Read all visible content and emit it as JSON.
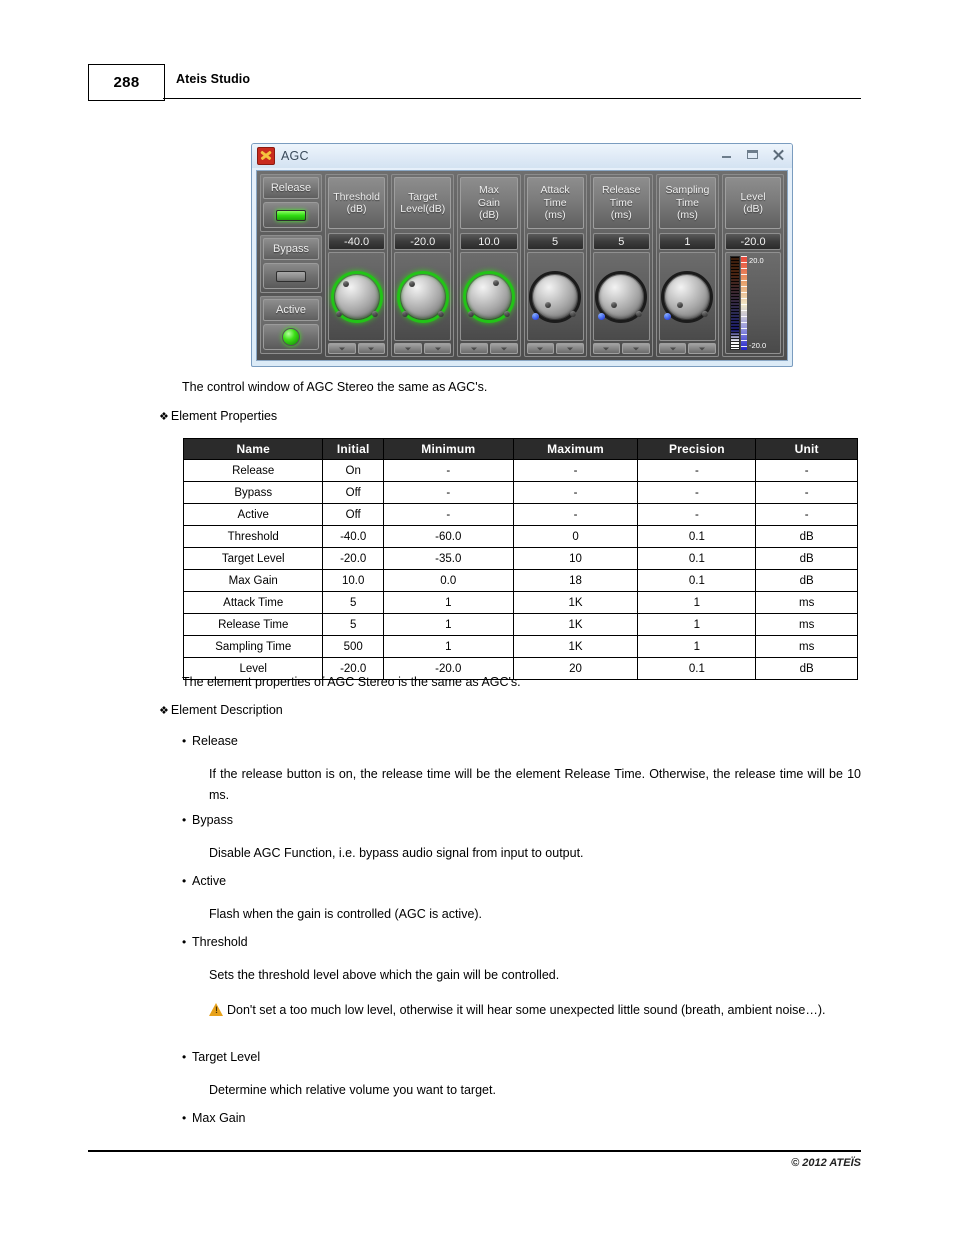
{
  "page": {
    "number": "288",
    "header_title": "Ateis Studio",
    "footer_copyright": "© 2012 ATEÏS"
  },
  "agc_window": {
    "title": "AGC",
    "app_icon": "ateis-logo-icon",
    "window_buttons": {
      "minimize": "minimize-icon",
      "maximize": "maximize-icon",
      "close": "close-icon"
    },
    "toggles": [
      {
        "label": "Release",
        "state": "on",
        "indicator": "led-bar"
      },
      {
        "label": "Bypass",
        "state": "off",
        "indicator": "led-bar"
      },
      {
        "label": "Active",
        "state": "on",
        "indicator": "led-round"
      }
    ],
    "parameters": [
      {
        "title_line1": "Threshold",
        "title_line2": "(dB)",
        "value": "-40.0",
        "knob_style": "green"
      },
      {
        "title_line1": "Target",
        "title_line2": "Level(dB)",
        "value": "-20.0",
        "knob_style": "green"
      },
      {
        "title_line1": "Max",
        "title_line2": "Gain",
        "title_line3": "(dB)",
        "value": "10.0",
        "knob_style": "green"
      },
      {
        "title_line1": "Attack",
        "title_line2": "Time",
        "title_line3": "(ms)",
        "value": "5",
        "knob_style": "dark"
      },
      {
        "title_line1": "Release",
        "title_line2": "Time",
        "title_line3": "(ms)",
        "value": "5",
        "knob_style": "dark"
      },
      {
        "title_line1": "Sampling",
        "title_line2": "Time",
        "title_line3": "(ms)",
        "value": "1",
        "knob_style": "dark"
      }
    ],
    "meter": {
      "title_line1": "Level",
      "title_line2": "(dB)",
      "value": "-20.0",
      "scale_top": "20.0",
      "scale_bottom": "-20.0"
    }
  },
  "body": {
    "intro_paragraph": "The control window of AGC Stereo the same as AGC's.",
    "section_element_properties": "Element Properties",
    "after_table_paragraph": "The element properties of AGC Stereo is the same as AGC's.",
    "section_element_description": "Element Description",
    "descriptions": [
      {
        "term": "Release",
        "text": "If the release button is on,  the release time will be the element Release Time.  Otherwise, the release time will be 10 ms."
      },
      {
        "term": "Bypass",
        "text": "Disable AGC Function, i.e. bypass audio signal from input to output."
      },
      {
        "term": "Active",
        "text": "Flash when the gain is controlled (AGC is active)."
      },
      {
        "term": "Threshold",
        "text": "Sets the threshold level above which the gain will be controlled.",
        "warning": "Don't set a too much low level, otherwise it will hear some unexpected little sound (breath, ambient noise…)."
      },
      {
        "term": "Target Level",
        "text": "Determine which relative volume you want to target."
      },
      {
        "term": "Max Gain",
        "text": ""
      }
    ]
  },
  "table": {
    "headers": [
      "Name",
      "Initial",
      "Minimum",
      "Maximum",
      "Precision",
      "Unit"
    ],
    "rows": [
      [
        "Release",
        "On",
        "-",
        "-",
        "-",
        "-"
      ],
      [
        "Bypass",
        "Off",
        "-",
        "-",
        "-",
        "-"
      ],
      [
        "Active",
        "Off",
        "-",
        "-",
        "-",
        "-"
      ],
      [
        "Threshold",
        "-40.0",
        "-60.0",
        "0",
        "0.1",
        "dB"
      ],
      [
        "Target Level",
        "-20.0",
        "-35.0",
        "10",
        "0.1",
        "dB"
      ],
      [
        "Max Gain",
        "10.0",
        "0.0",
        "18",
        "0.1",
        "dB"
      ],
      [
        "Attack Time",
        "5",
        "1",
        "1K",
        "1",
        "ms"
      ],
      [
        "Release Time",
        "5",
        "1",
        "1K",
        "1",
        "ms"
      ],
      [
        "Sampling Time",
        "500",
        "1",
        "1K",
        "1",
        "ms"
      ],
      [
        "Level",
        "-20.0",
        "-20.0",
        "20",
        "0.1",
        "dB"
      ]
    ]
  }
}
